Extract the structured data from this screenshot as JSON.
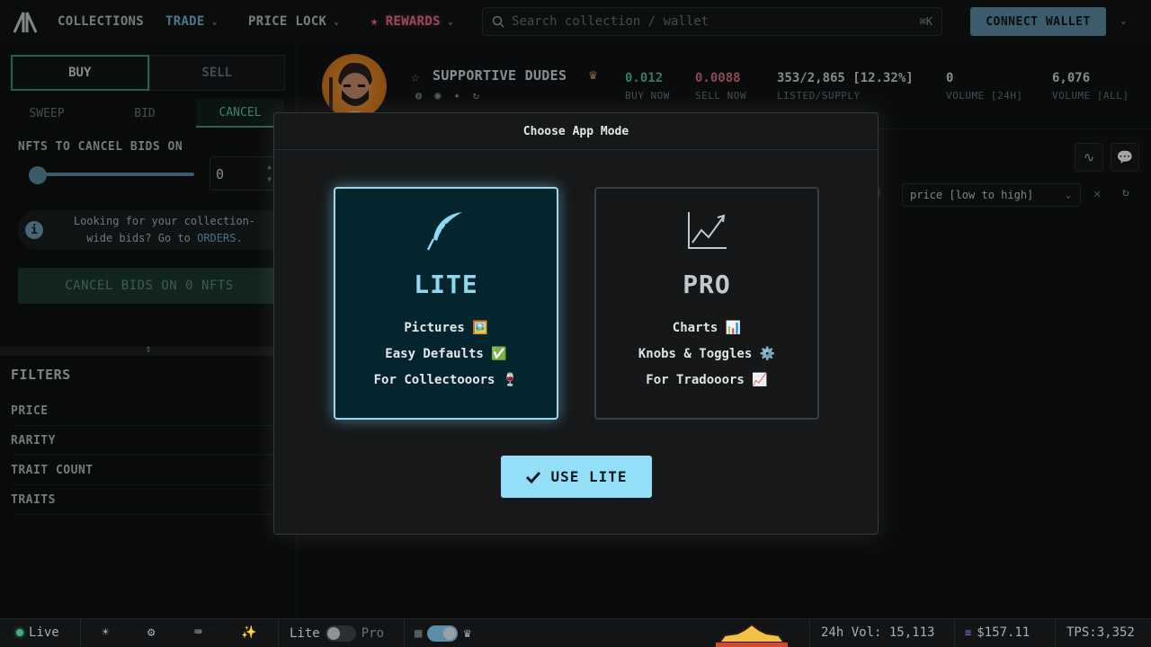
{
  "nav": {
    "collections": "COLLECTIONS",
    "trade": "TRADE",
    "price_lock": "PRICE LOCK",
    "rewards": "REWARDS",
    "search_placeholder": "Search collection / wallet",
    "search_shortcut": "⌘K",
    "connect_wallet": "CONNECT WALLET"
  },
  "left_panel": {
    "buy": "BUY",
    "sell": "SELL",
    "tabs": [
      "SWEEP",
      "BID",
      "CANCEL"
    ],
    "active_tab": "CANCEL",
    "cancel_label": "NFTS TO CANCEL BIDS ON",
    "quantity": "0",
    "info_text": "Looking for your collection-wide bids? Go to",
    "info_link": "ORDERS",
    "info_tail": ".",
    "cancel_button": "CANCEL BIDS ON 0 NFTS",
    "filters_title": "FILTERS",
    "filters": [
      "PRICE",
      "RARITY",
      "TRAIT COUNT",
      "TRAITS"
    ]
  },
  "collection": {
    "name": "SUPPORTIVE DUDES",
    "stats": [
      {
        "value": "0.012",
        "label": "BUY NOW"
      },
      {
        "value": "0.0088",
        "label": "SELL NOW"
      },
      {
        "value": "353/2,865 [12.32%]",
        "label": "LISTED/SUPPLY"
      },
      {
        "value": "0",
        "label": "VOLUME [24H]"
      },
      {
        "value": "6,076",
        "label": "VOLUME [ALL]"
      }
    ],
    "sort": "price [low to high]"
  },
  "modal": {
    "title": "Choose App Mode",
    "lite": {
      "title": "LITE",
      "features": [
        "Pictures 🖼️",
        "Easy Defaults ✅",
        "For Collectooors 🍷"
      ]
    },
    "pro": {
      "title": "PRO",
      "features": [
        "Charts 📊",
        "Knobs & Toggles ⚙️",
        "For Tradooors 📈"
      ]
    },
    "use_button": "USE LITE"
  },
  "status_bar": {
    "live": "Live",
    "lite": "Lite",
    "pro": "Pro",
    "vol_24h": "24h Vol: 15,113",
    "sol_price": "$157.11",
    "tps": "TPS:3,352"
  },
  "colors": {
    "accent_green": "#3f9470",
    "accent_blue": "#5d8ea7",
    "lite_cyan": "#93dff7",
    "rewards_pink": "#e3768f"
  }
}
